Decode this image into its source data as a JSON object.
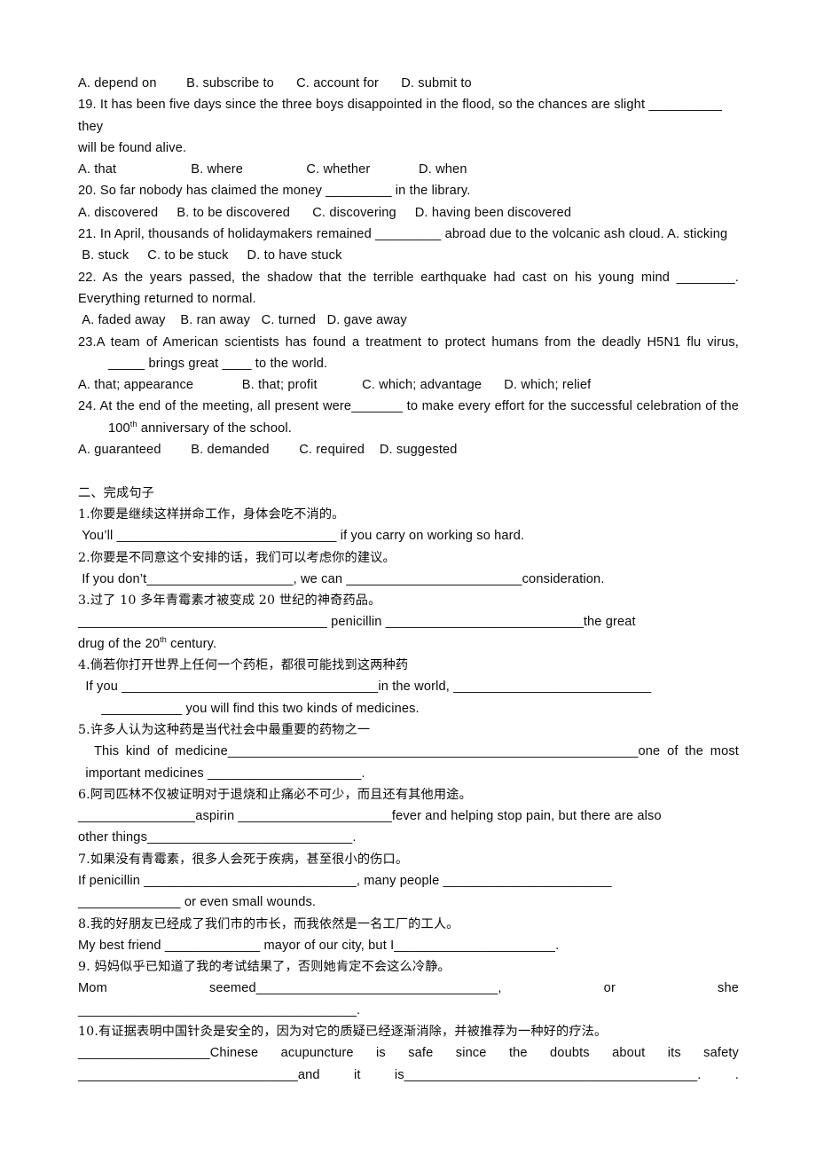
{
  "document": {
    "type": "english-exam-worksheet",
    "language_mix": [
      "en",
      "zh-CN"
    ],
    "section_one_tail": {
      "q18_options": "A. depend on        B. subscribe to      C. account for      D. submit to",
      "questions": [
        {
          "number": "19",
          "stem": "19. It has been five days since the three boys disappointed in the flood, so the chances are slight __________ they",
          "stem_cont": "will be found alive.",
          "options": "A. that                    B. where                 C. whether             D. when"
        },
        {
          "number": "20",
          "stem": "20. So far nobody has claimed the money _________ in the library.",
          "options": "A. discovered     B. to be discovered      C. discovering     D. having been discovered"
        },
        {
          "number": "21",
          "stem": "21. In April, thousands of holidaymakers remained _________ abroad due to the volcanic ash cloud. A. sticking",
          "options": " B. stuck     C. to be stuck     D. to have stuck"
        },
        {
          "number": "22",
          "stem": "22. As the years passed, the shadow that the terrible earthquake had cast on his young mind ________.",
          "stem_cont": "Everything returned to normal.",
          "options": " A. faded away    B. ran away   C. turned   D. gave away"
        },
        {
          "number": "23",
          "stem": "23.A team of American scientists has found a treatment to protect humans from the deadly H5N1 flu virus,",
          "stem_cont": "_____ brings great ____ to the world.",
          "options": "A. that; appearance             B. that; profit            C. which; advantage      D. which; relief"
        },
        {
          "number": "24",
          "stem": "24. At the end of the meeting, all present were_______ to make every effort for the successful celebration of the",
          "stem_cont_pre": "100",
          "stem_cont_sup": "th",
          "stem_cont_post": " anniversary of the school.",
          "options": "A. guaranteed        B. demanded        C. required    D. suggested"
        }
      ]
    },
    "section_two": {
      "heading": "二、完成句子",
      "items": [
        {
          "number": "1",
          "chinese": "1.你要是继续这样拼命工作，身体会吃不消的。",
          "lines": [
            " You’ll ______________________________ if you carry on working so hard."
          ]
        },
        {
          "number": "2",
          "chinese": "2.你要是不同意这个安排的话，我们可以考虑你的建议。",
          "lines": [
            " If you don’t____________________, we can ________________________consideration."
          ]
        },
        {
          "number": "3",
          "chinese_pre": "3.过了 10 多年青霉素才被变成 20 世纪的神奇药品。",
          "lines": [
            "__________________________________ penicillin ___________________________the great"
          ],
          "line_sup_pre": "drug of the 20",
          "line_sup": "th",
          "line_sup_post": " century."
        },
        {
          "number": "4",
          "chinese": "4.倘若你打开世界上任何一个药柜，都很可能找到这两种药",
          "lines": [
            "  If you ___________________________________in the world, ___________________________",
            "  ___________ you will find this two kinds of medicines."
          ]
        },
        {
          "number": "5",
          "chinese": "5.许多人认为这种药是当代社会中最重要的药物之一",
          "justified_line": "This kind of medicine________________________________________________________one of the most",
          "lines": [
            "  important medicines _____________________."
          ]
        },
        {
          "number": "6",
          "chinese": "6.阿司匹林不仅被证明对于退烧和止痛必不可少，而且还有其他用途。",
          "lines": [
            "________________aspirin _____________________fever and helping stop pain, but there are also",
            "other things____________________________."
          ]
        },
        {
          "number": "7",
          "chinese": "7.如果没有青霉素，很多人会死于疾病，甚至很小的伤口。",
          "lines": [
            "If penicillin _____________________________, many people _______________________",
            "______________ or even small wounds."
          ]
        },
        {
          "number": "8",
          "chinese": "8.我的好朋友已经成了我们市的市长，而我依然是一名工厂的工人。",
          "lines": [
            "My best friend _____________ mayor of our city, but I______________________."
          ]
        },
        {
          "number": "9",
          "chinese": "9. 妈妈似乎已知道了我的考试结果了，否则她肯定不会这么冷静。",
          "justified_line": "Mom seemed_________________________________, or she",
          "lines": [
            "______________________________________."
          ]
        },
        {
          "number": "10",
          "chinese": "10.有证据表明中国针灸是安全的，因为对它的质疑已经逐渐消除，并被推荐为一种好的疗法。",
          "justified_line": "__________________Chinese acupuncture is safe since the doubts about its safety",
          "justified_line_2": "______________________________and it is________________________________________. .",
          "lines": []
        }
      ]
    }
  }
}
